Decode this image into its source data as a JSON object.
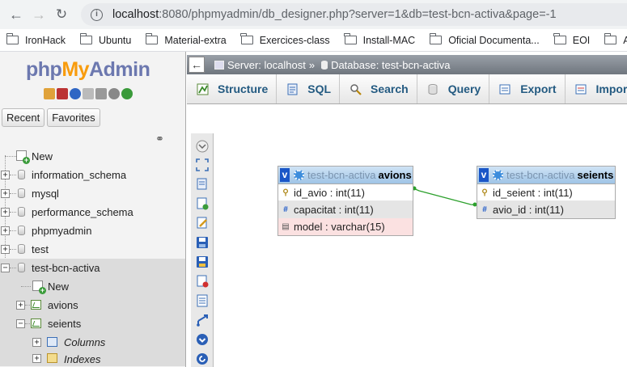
{
  "browser": {
    "url_host": "localhost",
    "url_path": ":8080/phpmyadmin/db_designer.php?server=1&db=test-bcn-activa&page=-1",
    "bookmarks": [
      "IronHack",
      "Ubuntu",
      "Material-extra",
      "Exercices-class",
      "Install-MAC",
      "Oficial Documenta...",
      "EOI",
      "A"
    ]
  },
  "logo": {
    "php": "php",
    "my": "My",
    "admin": "Admin"
  },
  "sidebar": {
    "recent_label": "Recent",
    "favorites_label": "Favorites",
    "tree": {
      "new_label": "New",
      "databases": [
        "information_schema",
        "mysql",
        "performance_schema",
        "phpmyadmin",
        "test"
      ],
      "active_db": "test-bcn-activa",
      "active_children": {
        "new_label": "New",
        "tables": [
          "avions",
          "seients"
        ],
        "seients_children": [
          "Columns",
          "Indexes"
        ]
      }
    }
  },
  "breadcrumb": {
    "server": "Server: localhost",
    "separator": "»",
    "database": "Database: test-bcn-activa"
  },
  "tabs": [
    "Structure",
    "SQL",
    "Search",
    "Query",
    "Export",
    "Import"
  ],
  "designer": {
    "tables": [
      {
        "db": "test-bcn-activa",
        "name": "avions",
        "columns": [
          {
            "text": "id_avio : int(11)",
            "icon": "key-icon"
          },
          {
            "text": "capacitat : int(11)",
            "icon": "hash-icon"
          },
          {
            "text": "model : varchar(15)",
            "icon": "text-icon"
          }
        ]
      },
      {
        "db": "test-bcn-activa",
        "name": "seients",
        "columns": [
          {
            "text": "id_seient : int(11)",
            "icon": "key-icon"
          },
          {
            "text": "avio_id : int(11)",
            "icon": "hash-icon"
          }
        ]
      }
    ],
    "relation_color": "#2ca02c"
  }
}
